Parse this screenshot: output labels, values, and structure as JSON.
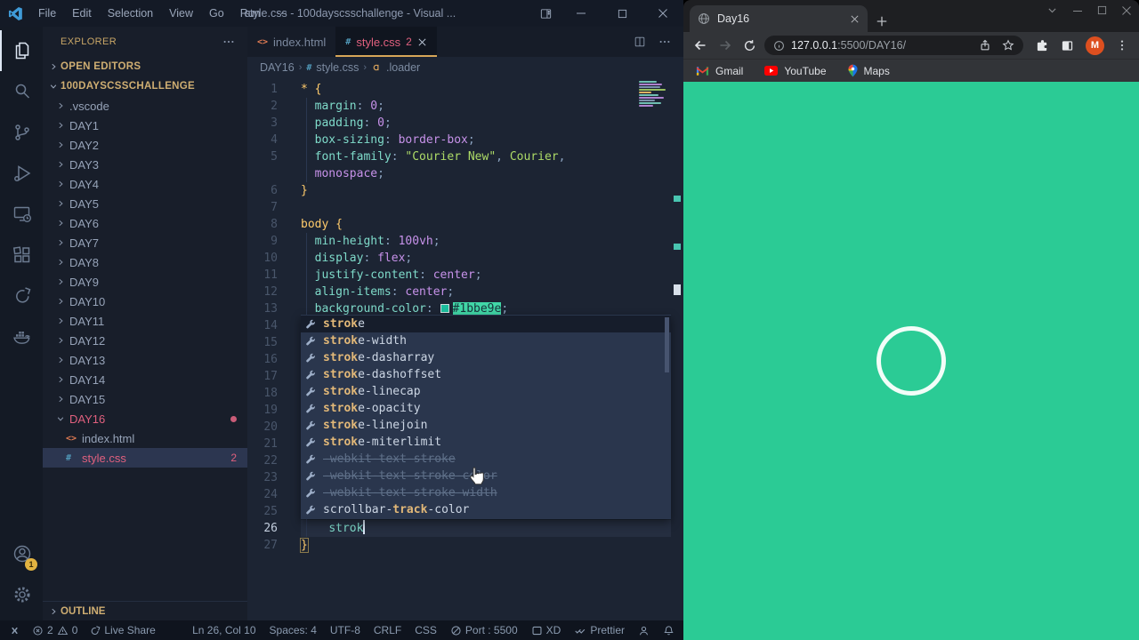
{
  "colors": {
    "css_color_value": "#1bbe9e",
    "page_green": "#2bcb95",
    "accent_gold": "#d7a658",
    "error_pink": "#e0607e",
    "match_gold": "#e2b878"
  },
  "vscode": {
    "titlebar": {
      "menus": [
        "File",
        "Edit",
        "Selection",
        "View",
        "Go",
        "Run",
        "⋯"
      ],
      "title": "style.css - 100dayscsschallenge - Visual ..."
    },
    "activity_bar": {
      "items": [
        "explorer",
        "search",
        "source-control",
        "run-debug",
        "remote-explorer",
        "extensions",
        "live-share",
        "docker"
      ],
      "account_badge": "1"
    },
    "explorer": {
      "header": "EXPLORER",
      "open_editors_label": "OPEN EDITORS",
      "project_label": "100DAYSCSSCHALLENGE",
      "outline_label": "OUTLINE",
      "folders": [
        ".vscode",
        "DAY1",
        "DAY2",
        "DAY3",
        "DAY4",
        "DAY5",
        "DAY6",
        "DAY7",
        "DAY8",
        "DAY9",
        "DAY10",
        "DAY11",
        "DAY12",
        "DAY13",
        "DAY14",
        "DAY15"
      ],
      "day16": {
        "label": "DAY16",
        "files": [
          {
            "label": "index.html",
            "icon": "html"
          },
          {
            "label": "style.css",
            "icon": "css",
            "badge": "2",
            "selected": true
          }
        ]
      }
    },
    "tabs": [
      {
        "label": "index.html",
        "icon": "html",
        "active": false
      },
      {
        "label": "style.css",
        "icon": "css",
        "badge": "2",
        "active": true
      }
    ],
    "breadcrumb": {
      "folder": "DAY16",
      "file": "style.css",
      "symbol": ".loader"
    },
    "editor": {
      "lines": [
        {
          "n": "1",
          "s": [
            [
              "br",
              "* {"
            ]
          ]
        },
        {
          "n": "2",
          "s": [
            [
              "sp",
              "  "
            ],
            [
              "pr",
              "margin"
            ],
            [
              "pu",
              ": "
            ],
            [
              "va",
              "0"
            ],
            [
              "pu",
              ";"
            ]
          ]
        },
        {
          "n": "3",
          "s": [
            [
              "sp",
              "  "
            ],
            [
              "pr",
              "padding"
            ],
            [
              "pu",
              ": "
            ],
            [
              "va",
              "0"
            ],
            [
              "pu",
              ";"
            ]
          ]
        },
        {
          "n": "4",
          "s": [
            [
              "sp",
              "  "
            ],
            [
              "pr",
              "box-sizing"
            ],
            [
              "pu",
              ": "
            ],
            [
              "va",
              "border-box"
            ],
            [
              "pu",
              ";"
            ]
          ]
        },
        {
          "n": "5",
          "s": [
            [
              "sp",
              "  "
            ],
            [
              "pr",
              "font-family"
            ],
            [
              "pu",
              ": "
            ],
            [
              "st",
              "\"Courier New\""
            ],
            [
              "pu",
              ", "
            ],
            [
              "st",
              "Courier"
            ],
            [
              "pu",
              ","
            ]
          ]
        },
        {
          "n": "",
          "s": [
            [
              "sp",
              "  "
            ],
            [
              "va",
              "monospace"
            ],
            [
              "pu",
              ";"
            ]
          ]
        },
        {
          "n": "6",
          "s": [
            [
              "br",
              "}"
            ]
          ]
        },
        {
          "n": "7",
          "s": []
        },
        {
          "n": "8",
          "s": [
            [
              "br",
              "body {"
            ]
          ]
        },
        {
          "n": "9",
          "s": [
            [
              "sp",
              "  "
            ],
            [
              "pr",
              "min-height"
            ],
            [
              "pu",
              ": "
            ],
            [
              "va",
              "100vh"
            ],
            [
              "pu",
              ";"
            ]
          ]
        },
        {
          "n": "10",
          "s": [
            [
              "sp",
              "  "
            ],
            [
              "pr",
              "display"
            ],
            [
              "pu",
              ": "
            ],
            [
              "va",
              "flex"
            ],
            [
              "pu",
              ";"
            ]
          ]
        },
        {
          "n": "11",
          "s": [
            [
              "sp",
              "  "
            ],
            [
              "pr",
              "justify-content"
            ],
            [
              "pu",
              ": "
            ],
            [
              "va",
              "center"
            ],
            [
              "pu",
              ";"
            ]
          ]
        },
        {
          "n": "12",
          "s": [
            [
              "sp",
              "  "
            ],
            [
              "pr",
              "align-items"
            ],
            [
              "pu",
              ": "
            ],
            [
              "va",
              "center"
            ],
            [
              "pu",
              ";"
            ]
          ]
        },
        {
          "n": "13",
          "s": [
            [
              "sp",
              "  "
            ],
            [
              "pr",
              "background-color"
            ],
            [
              "pu",
              ": "
            ],
            [
              "sw",
              ""
            ],
            [
              "hl",
              "#1bbe9e"
            ],
            [
              "pu",
              ";"
            ]
          ]
        },
        {
          "n": "14",
          "s": []
        },
        {
          "n": "15",
          "s": []
        },
        {
          "n": "16",
          "s": []
        },
        {
          "n": "17",
          "s": []
        },
        {
          "n": "18",
          "s": []
        },
        {
          "n": "19",
          "s": []
        },
        {
          "n": "20",
          "s": []
        },
        {
          "n": "21",
          "s": []
        },
        {
          "n": "22",
          "s": []
        },
        {
          "n": "23",
          "s": []
        },
        {
          "n": "24",
          "s": []
        },
        {
          "n": "25",
          "s": []
        },
        {
          "n": "26",
          "s": [
            [
              "sp",
              "    "
            ],
            [
              "ty",
              "strok"
            ],
            [
              "cu",
              ""
            ]
          ],
          "cur": true
        },
        {
          "n": "27",
          "s": [
            [
              "bm",
              "}"
            ]
          ]
        }
      ]
    },
    "suggest": {
      "items": [
        {
          "before": "",
          "match": "strok",
          "after": "e",
          "selected": true
        },
        {
          "before": "",
          "match": "strok",
          "after": "e-width"
        },
        {
          "before": "",
          "match": "strok",
          "after": "e-dasharray"
        },
        {
          "before": "",
          "match": "strok",
          "after": "e-dashoffset"
        },
        {
          "before": "",
          "match": "strok",
          "after": "e-linecap"
        },
        {
          "before": "",
          "match": "strok",
          "after": "e-opacity"
        },
        {
          "before": "",
          "match": "strok",
          "after": "e-linejoin"
        },
        {
          "before": "",
          "match": "strok",
          "after": "e-miterlimit"
        },
        {
          "before": "-webkit-text-",
          "match": "strok",
          "after": "e",
          "deprecated": true
        },
        {
          "before": "-webkit-text-",
          "match": "strok",
          "after": "e-color",
          "deprecated": true
        },
        {
          "before": "-webkit-text-",
          "match": "strok",
          "after": "e-width",
          "deprecated": true
        },
        {
          "before": "scrollbar-",
          "match": "track",
          "after": "-color"
        }
      ]
    },
    "statusbar": {
      "errors": "2",
      "warnings": "0",
      "live_share": "Live Share",
      "right": [
        {
          "name": "cursor-position",
          "label": "Ln 26, Col 10"
        },
        {
          "name": "indentation",
          "label": "Spaces: 4"
        },
        {
          "name": "encoding",
          "label": "UTF-8"
        },
        {
          "name": "eol",
          "label": "CRLF"
        },
        {
          "name": "language-mode",
          "label": "CSS"
        },
        {
          "name": "live-server-port",
          "icon": "port",
          "label": "Port : 5500"
        },
        {
          "name": "xd-extension",
          "icon": "xd",
          "label": "XD"
        },
        {
          "name": "prettier",
          "icon": "prettier",
          "label": "Prettier"
        },
        {
          "name": "feedback",
          "icon": "person",
          "label": ""
        },
        {
          "name": "notifications",
          "icon": "bell",
          "label": ""
        }
      ]
    }
  },
  "browser": {
    "tab_title": "Day16",
    "url_host": "127.0.0.1",
    "url_path": ":5500/DAY16/",
    "avatar": "M",
    "bookmarks": [
      {
        "icon": "gmail",
        "label": "Gmail"
      },
      {
        "icon": "youtube",
        "label": "YouTube"
      },
      {
        "icon": "maps",
        "label": "Maps"
      }
    ]
  }
}
